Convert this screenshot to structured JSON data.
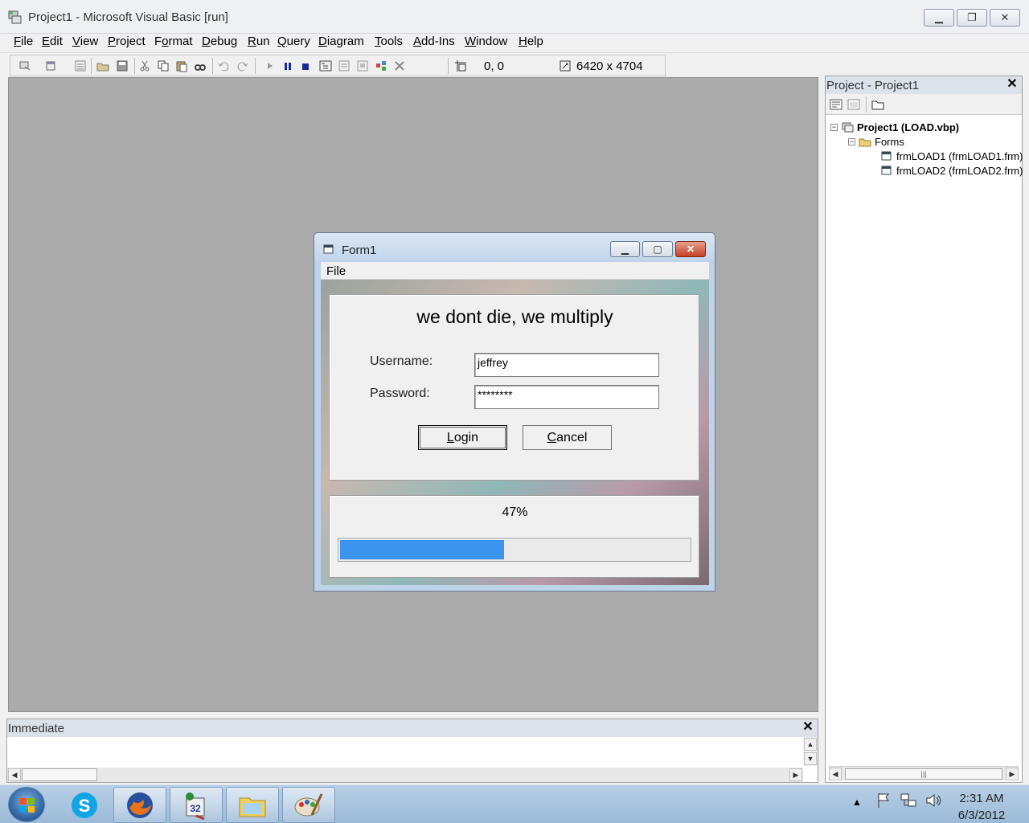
{
  "window": {
    "title": "Project1 - Microsoft Visual Basic [run]"
  },
  "menu": [
    {
      "u": "F",
      "rest": "ile"
    },
    {
      "u": "E",
      "rest": "dit"
    },
    {
      "u": "V",
      "rest": "iew"
    },
    {
      "u": "P",
      "rest": "roject"
    },
    {
      "u": "F",
      "rest": "ormat",
      "pre": "",
      "label": "Format"
    },
    {
      "u": "D",
      "rest": "ebug"
    },
    {
      "u": "R",
      "rest": "un"
    },
    {
      "u": "Q",
      "rest": "uery"
    },
    {
      "u": "D",
      "rest": "iagram"
    },
    {
      "u": "T",
      "rest": "ools"
    },
    {
      "u": "A",
      "rest": "dd-Ins"
    },
    {
      "u": "W",
      "rest": "indow"
    },
    {
      "u": "H",
      "rest": "elp"
    }
  ],
  "toolbar": {
    "position": "0, 0",
    "size": "6420 x 4704"
  },
  "form1": {
    "title": "Form1",
    "menu_file": "File",
    "heading": "we dont die, we multiply",
    "username_label": "Username:",
    "password_label": "Password:",
    "username_value": "jeffrey",
    "password_value": "********",
    "login_u": "L",
    "login_rest": "ogin",
    "cancel_u": "C",
    "cancel_rest": "ancel",
    "progress_text": "47%",
    "progress_value": 0.47,
    "progress_color": "#3c93ec"
  },
  "project_panel": {
    "title": "Project - Project1",
    "root": "Project1 (LOAD.vbp)",
    "folder": "Forms",
    "items": [
      "frmLOAD1 (frmLOAD1.frm)",
      "frmLOAD2 (frmLOAD2.frm)"
    ]
  },
  "immediate": {
    "title": "Immediate"
  },
  "taskbar": {
    "apps": [
      "skype-icon",
      "firefox-icon",
      "vb6-icon",
      "explorer-icon",
      "paint-icon"
    ],
    "time": "2:31 AM",
    "date": "6/3/2012"
  },
  "colors": {
    "mdi_background": "#ababab",
    "accent": "#3c93ec"
  }
}
